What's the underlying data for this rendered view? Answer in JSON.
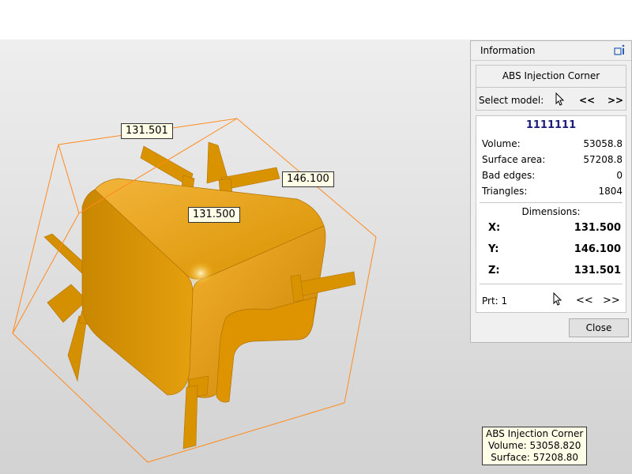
{
  "viewport": {
    "labels": {
      "z_dimension": "131.501",
      "y_dimension": "146.100",
      "x_dimension": "131.500"
    },
    "tooltip": {
      "line1": "ABS Injection Corner",
      "line2": "Volume: 53058.820",
      "line3": "Surface: 57208.80"
    },
    "colors": {
      "model": "#e8a000",
      "bbox": "#ff8a1e"
    }
  },
  "panel": {
    "title": "Information",
    "dock_icon": "dock-info-icon",
    "model_name": "ABS Injection Corner",
    "select_label": "Select model:",
    "prev_model": "<<",
    "next_model": ">>",
    "model_id": "1111111",
    "stats": [
      {
        "label": "Volume:",
        "value": "53058.8"
      },
      {
        "label": "Surface area:",
        "value": "57208.8"
      },
      {
        "label": "Bad edges:",
        "value": "0"
      },
      {
        "label": "Triangles:",
        "value": "1804"
      }
    ],
    "dimensions_title": "Dimensions:",
    "dimensions": [
      {
        "label": "X:",
        "value": "131.500"
      },
      {
        "label": "Y:",
        "value": "146.100"
      },
      {
        "label": "Z:",
        "value": "131.501"
      }
    ],
    "part_label": "Prt: 1",
    "prev_part": "<<",
    "next_part": ">>",
    "close_label": "Close"
  }
}
